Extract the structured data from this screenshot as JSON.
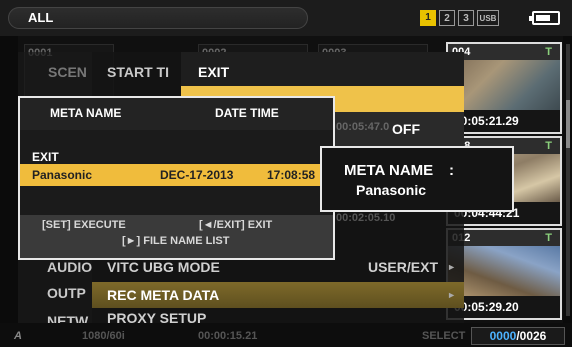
{
  "topbar": {
    "filter_label": "ALL",
    "slots": [
      "1",
      "2",
      "3",
      "USB"
    ],
    "active_slot": "1"
  },
  "thumbs": {
    "bg_headers": [
      "0001",
      "0002",
      "0003"
    ],
    "bg_t": "T",
    "photos": [
      {
        "num": "004",
        "t": "T",
        "timecode": "00:05:21.29"
      },
      {
        "num": "008",
        "t": "T",
        "timecode": "00:04:44:21"
      },
      {
        "num": "012",
        "t": "T",
        "timecode": "00:05:29.20"
      }
    ]
  },
  "left_labels": [
    "SCEN",
    "AUDIO",
    "OUTP",
    "NETW"
  ],
  "menu": {
    "start_label": "START TI",
    "exit_label": "EXIT",
    "off_value": "OFF",
    "bg_time": "00:05:47.0",
    "bg_time2": "00:02:05.10",
    "vitc_label": "VITC UBG MODE",
    "vitc_value": "USER/EXT",
    "rec_meta_label": "REC META DATA",
    "proxy_label": "PROXY SETUP",
    "bottom_bg1": "1080/60i",
    "bottom_bg2": "00:00:15.21",
    "bottom_bg3": "SELECT"
  },
  "dialog": {
    "col_meta_name": "META NAME",
    "col_date_time": "DATE TIME",
    "exit_row": "EXIT",
    "selected_name": "Panasonic",
    "selected_date": "DEC-17-2013",
    "selected_time": "17:08:58",
    "footer_execute": "[SET] EXECUTE",
    "footer_exit": "[◄/EXIT] EXIT",
    "footer_list": "[►] FILE NAME LIST"
  },
  "meta_box": {
    "label": "META NAME",
    "colon": ":",
    "value": "Panasonic"
  },
  "status": {
    "counter_current": "0000",
    "counter_total": "/0026"
  }
}
